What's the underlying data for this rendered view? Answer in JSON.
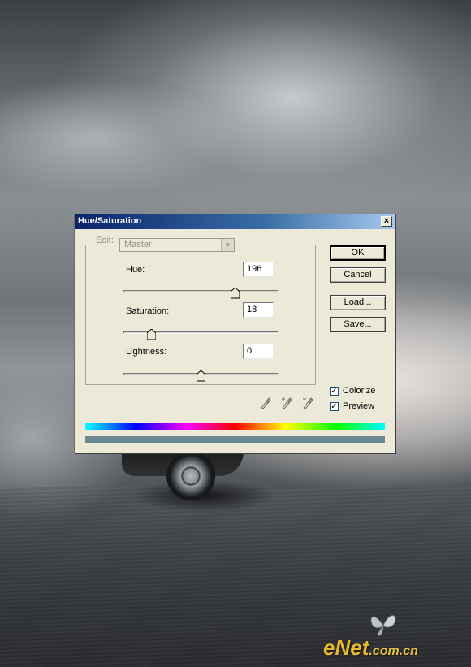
{
  "dialog": {
    "title": "Hue/Saturation",
    "close_glyph": "×",
    "edit": {
      "label": "Edit:",
      "selected": "Master"
    },
    "fields": {
      "hue": {
        "label": "Hue:",
        "value": "196",
        "slider_fraction": 0.72
      },
      "saturation": {
        "label": "Saturation:",
        "value": "18",
        "slider_fraction": 0.18
      },
      "lightness": {
        "label": "Lightness:",
        "value": "0",
        "slider_fraction": 0.5
      }
    },
    "buttons": {
      "ok": "OK",
      "cancel": "Cancel",
      "load": "Load...",
      "save": "Save..."
    },
    "checkboxes": {
      "colorize": {
        "label": "Colorize",
        "checked": true
      },
      "preview": {
        "label": "Preview",
        "checked": true
      }
    },
    "result_color": "#6a8890",
    "icons": [
      "eyedropper-icon",
      "eyedropper-plus-icon",
      "eyedropper-minus-icon"
    ]
  },
  "watermark": {
    "brand": "eNet",
    "domain": ".com.cn"
  }
}
